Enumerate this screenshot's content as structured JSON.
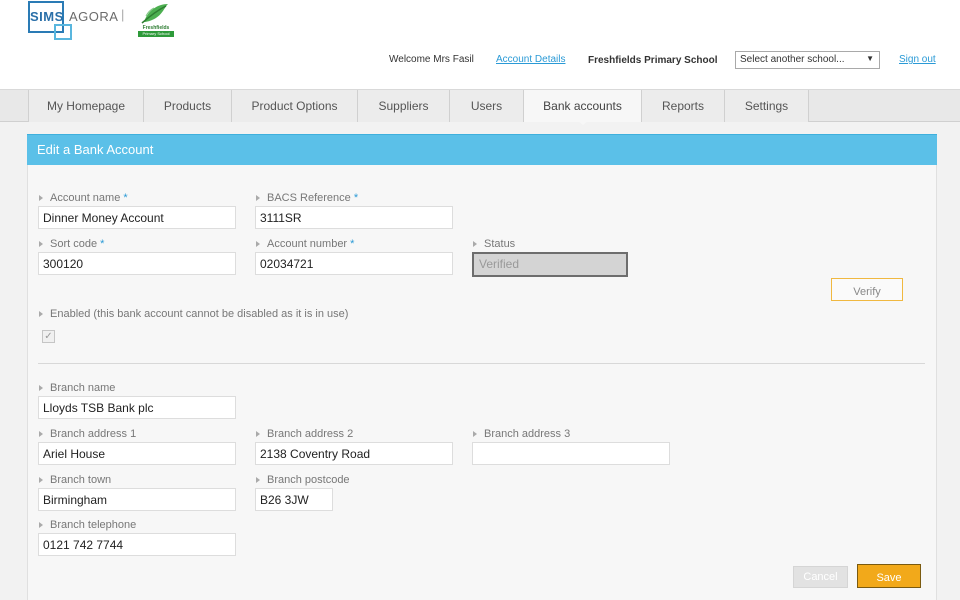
{
  "brand": {
    "sims": "SIMS",
    "agora": "AGORA",
    "separator": "|",
    "crest_line1": "Freshfields",
    "crest_line2": "Primary School"
  },
  "header": {
    "welcome": "Welcome Mrs Fasil",
    "account_details": "Account Details",
    "school_name": "Freshfields Primary School",
    "school_select": "Select another school...",
    "sign_out": "Sign out"
  },
  "tabs": [
    {
      "label": "My Homepage"
    },
    {
      "label": "Products"
    },
    {
      "label": "Product Options"
    },
    {
      "label": "Suppliers"
    },
    {
      "label": "Users"
    },
    {
      "label": "Bank accounts",
      "active": true
    },
    {
      "label": "Reports"
    },
    {
      "label": "Settings"
    }
  ],
  "form": {
    "title": "Edit a Bank Account",
    "account_name": {
      "label": "Account name",
      "required": "*",
      "value": "Dinner Money Account"
    },
    "bacs_reference": {
      "label": "BACS Reference",
      "required": "*",
      "value": "3111SR"
    },
    "sort_code": {
      "label": "Sort code",
      "required": "*",
      "value": "300120"
    },
    "account_number": {
      "label": "Account number",
      "required": "*",
      "value": "02034721"
    },
    "status": {
      "label": "Status",
      "value": "Verified"
    },
    "verify_button": "Verify",
    "enabled": {
      "label": "Enabled (this bank account cannot be disabled as it is in use)",
      "checked": true,
      "check_glyph": "✓"
    },
    "branch_name": {
      "label": "Branch name",
      "value": "Lloyds TSB Bank plc"
    },
    "branch_address_1": {
      "label": "Branch address 1",
      "value": "Ariel House"
    },
    "branch_address_2": {
      "label": "Branch address 2",
      "value": "2138 Coventry Road"
    },
    "branch_address_3": {
      "label": "Branch address 3",
      "value": ""
    },
    "branch_town": {
      "label": "Branch town",
      "value": "Birmingham"
    },
    "branch_postcode": {
      "label": "Branch postcode",
      "value": "B26 3JW"
    },
    "branch_telephone": {
      "label": "Branch telephone",
      "value": "0121 742 7744"
    },
    "cancel_button": "Cancel",
    "save_button": "Save"
  },
  "colors": {
    "accent": "#5bc0e8",
    "link": "#2a9ad6",
    "save": "#f2a91a",
    "verify_border": "#f0b840"
  }
}
